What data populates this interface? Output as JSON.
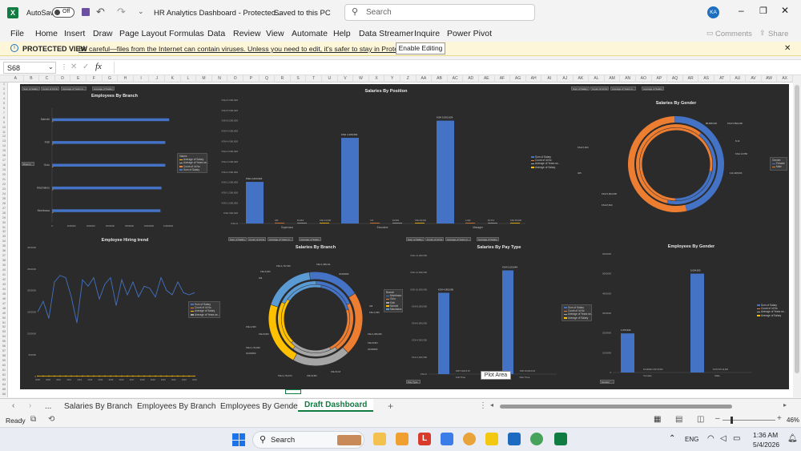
{
  "titlebar": {
    "autosave_label": "AutoSave",
    "autosave_state": "Off",
    "doc_title": "HR Analytics Dashboard - Protected...",
    "saved_status": "Saved to this PC",
    "search_placeholder": "Search",
    "user_initials": "KA"
  },
  "ribbon": {
    "tabs": [
      "File",
      "Home",
      "Insert",
      "Draw",
      "Page Layout",
      "Formulas",
      "Data",
      "Review",
      "View",
      "Automate",
      "Help",
      "Data Streamer",
      "Inquire",
      "Power Pivot"
    ],
    "comments_label": "Comments",
    "share_label": "Share"
  },
  "protected_view": {
    "label": "PROTECTED VIEW",
    "message": "Be careful—files from the Internet can contain viruses. Unless you need to edit, it's safer to stay in Protected View.",
    "button": "Enable Editing"
  },
  "formula_bar": {
    "name_box": "S68",
    "fx": "fx"
  },
  "columns": [
    "A",
    "B",
    "C",
    "D",
    "E",
    "F",
    "G",
    "H",
    "I",
    "J",
    "K",
    "L",
    "M",
    "N",
    "O",
    "P",
    "Q",
    "R",
    "S",
    "T",
    "U",
    "V",
    "W",
    "X",
    "Y",
    "Z",
    "AA",
    "AB",
    "AC",
    "AD",
    "AE",
    "AF",
    "AG",
    "AH",
    "AI",
    "AJ",
    "AK",
    "AL",
    "AM",
    "AN",
    "AO",
    "AP",
    "AQ",
    "AR",
    "AS",
    "AT",
    "AU",
    "AV",
    "AW",
    "AX"
  ],
  "filter_buttons": [
    "Sum of Salary",
    "Count of Id No",
    "Average of Years in...",
    "Average of Salary"
  ],
  "legend": {
    "title": "Values",
    "items": [
      "Average of Salary",
      "Average of Years se...",
      "Count of Id No",
      "Sum of Salary"
    ]
  },
  "charts": {
    "branch": {
      "title": "Employees By Branch",
      "categories": [
        "Nairobi",
        "Kisii",
        "Gulu",
        "Machakos",
        "Mombasa"
      ],
      "dropdown": "Branch"
    },
    "position": {
      "title": "Salaries By Position",
      "categories": [
        "Supervisor",
        "Executive",
        "Manager"
      ],
      "value_labels": [
        "KSH 2,024,624",
        "KSH 4,166,664",
        "KSH 5,002,624"
      ],
      "small_labels": [
        "453",
        "8.1463",
        "KSH 13,000",
        "471",
        "8.1549",
        "KSH 40,002",
        "1,022",
        "8.1713",
        "KSH 53,000"
      ],
      "y_ticks": [
        "KSH 6,000,000",
        "KSH 5,500,000",
        "KSH 5,000,000",
        "KSH 4,500,000",
        "KSH 4,000,000",
        "KSH 3,500,000",
        "KSH 3,000,000",
        "KSH 2,500,000",
        "KSH 2,000,000",
        "KSH 1,500,000",
        "KSH 1,000,000",
        "KSH 500,000",
        "KSH 0"
      ]
    },
    "gender": {
      "title": "Salaries By Gender",
      "legend_title": "Gender",
      "legend_items": [
        "Female",
        "Male"
      ],
      "labels": [
        "KSH 5,890,000",
        "8.14",
        "KSH 14,550",
        "114,448,000",
        "KSH 6,000",
        "425",
        "KSH 5,964,000",
        "KSH 8,810",
        "88,868,000"
      ]
    },
    "hiring": {
      "title": "Employee Hiring trend",
      "legend_items": [
        "Sum of Salary",
        "Count of Id No",
        "Average of Salary",
        "Average of Years se..."
      ],
      "y_ticks": [
        "3000000",
        "2500000",
        "2000000",
        "1500000",
        "1000000",
        "500000",
        "0"
      ],
      "years": [
        "2008",
        "2009",
        "2010",
        "2011",
        "2012",
        "2013",
        "2014",
        "2015",
        "2016",
        "2017",
        "2018",
        "2019",
        "2020",
        "2021",
        "2022",
        "2023"
      ],
      "series": [
        1500000,
        1750000,
        1350000,
        2200000,
        2350000,
        2300000,
        1850000,
        1250000,
        2250000,
        2100000,
        2300000,
        1800000,
        2150000,
        2300000,
        1650000,
        2250000,
        1900000,
        2200000,
        1850000,
        2100000,
        2050000,
        1850000,
        2300000,
        2000000,
        1900000,
        2200000,
        1950000,
        1900000,
        1950000
      ]
    },
    "branch_salary": {
      "title": "Salaries By Branch",
      "legend_title": "Branch",
      "legend_items": [
        "Mombasa",
        "Gulu",
        "Kisii",
        "Nairobi",
        "Machakos"
      ],
      "labels": [
        "KSH 1,737,000",
        "KSH 1,458,121",
        "KSH 6,000",
        "18,000000",
        "424",
        "424",
        "KSH 4,450",
        "KSH 1,665,000",
        "KSH 8,904",
        "18,000000",
        "KSH 2,000",
        "KSH 1,744,000",
        "18,000000",
        "KSH 1,744,974",
        "KSH 8,453",
        "KSH 8,117",
        "KSH 8,000"
      ]
    },
    "paytype": {
      "title": "Salaries By Pay Type",
      "categories": [
        "Full Time",
        "Part Time"
      ],
      "value_labels": [
        "KSH 4,000,000",
        "KSH 5,103,844"
      ],
      "small_labels": [
        "KSH 5,000 8.15",
        "KSH 43,000 8.15"
      ],
      "y_ticks": [
        "KSH 14,000,000",
        "KSH 12,000,000",
        "KSH 10,000,000",
        "KSH 8,000,000",
        "KSH 6,000,000",
        "KSH 4,000,000",
        "KSH 2,000,000",
        "KSH 0"
      ],
      "tooltip": "Plot Area",
      "dropdown": "Pay Type"
    },
    "emp_gender": {
      "title": "Employees By Gender",
      "categories": [
        "Female",
        "Male"
      ],
      "value_labels": [
        "1,979,624",
        "5,004,000"
      ],
      "small_labels": [
        "8.1446411 KSH 8,000",
        "8.15 KSH 14,000"
      ],
      "y_ticks": [
        "6000000",
        "5000000",
        "4000000",
        "3000000",
        "2000000",
        "1000000",
        "0"
      ],
      "dropdown": "Gender"
    }
  },
  "sheet_tabs": [
    "...",
    "Salaries By Branch",
    "Employees By Branch",
    "Employees By Gender",
    "Draft Dashboard"
  ],
  "status": {
    "ready": "Ready",
    "zoom": "46%"
  },
  "taskbar": {
    "search": "Search",
    "lang": "ENG",
    "time": "1:36 AM",
    "date": "5/4/2026"
  },
  "chart_data": [
    {
      "type": "bar",
      "title": "Employees By Branch",
      "categories": [
        "Nairobi",
        "Kisii",
        "Gulu",
        "Machakos",
        "Mombasa"
      ],
      "series": [
        {
          "name": "Sum of Salary",
          "values": [
            12100000,
            11700000,
            11700000,
            11300000,
            11200000
          ]
        }
      ],
      "x_ticks": [
        "0",
        "2000000",
        "4000000",
        "6000000",
        "8000000",
        "10000000",
        "12000000"
      ],
      "xlim": [
        0,
        12000000
      ]
    },
    {
      "type": "bar",
      "title": "Salaries By Position",
      "categories": [
        "Supervisor",
        "Executive",
        "Manager"
      ],
      "series": [
        {
          "name": "Sum of Salary",
          "values": [
            2024624,
            4166664,
            5002624
          ]
        }
      ],
      "ylim": [
        0,
        6000000
      ]
    },
    {
      "type": "pie",
      "title": "Salaries By Gender",
      "categories": [
        "Female",
        "Male"
      ],
      "values": [
        114448000,
        88868000
      ]
    },
    {
      "type": "line",
      "title": "Employee Hiring trend",
      "ylim": [
        0,
        3000000
      ]
    },
    {
      "type": "pie",
      "title": "Salaries By Branch",
      "categories": [
        "Mombasa",
        "Gulu",
        "Kisii",
        "Nairobi",
        "Machakos"
      ],
      "values": [
        18,
        22,
        20,
        22,
        18
      ]
    },
    {
      "type": "bar",
      "title": "Salaries By Pay Type",
      "categories": [
        "Full Time",
        "Part Time"
      ],
      "series": [
        {
          "name": "Sum of Salary",
          "values": [
            4000000,
            5103844
          ]
        }
      ],
      "ylim": [
        0,
        14000000
      ]
    },
    {
      "type": "bar",
      "title": "Employees By Gender",
      "categories": [
        "Female",
        "Male"
      ],
      "series": [
        {
          "name": "Sum of Salary",
          "values": [
            1979624,
            5004000
          ]
        }
      ],
      "ylim": [
        0,
        6000000
      ]
    }
  ]
}
